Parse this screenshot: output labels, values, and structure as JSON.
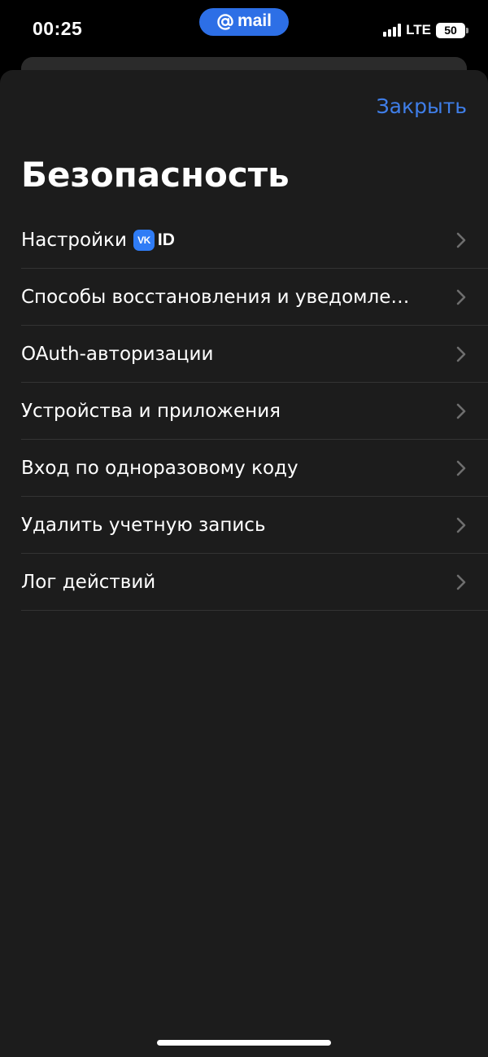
{
  "status_bar": {
    "time": "00:25",
    "app_pill_label": "mail",
    "network": "LTE",
    "battery": "50"
  },
  "sheet": {
    "close_label": "Закрыть",
    "title": "Безопасность"
  },
  "menu": {
    "items": [
      {
        "label": "Настройки",
        "badge_logo": "VK",
        "badge_text": "ID"
      },
      {
        "label": "Способы восстановления и уведомле…"
      },
      {
        "label": "OAuth-авторизации"
      },
      {
        "label": "Устройства и приложения"
      },
      {
        "label": "Вход по одноразовому коду"
      },
      {
        "label": "Удалить учетную запись"
      },
      {
        "label": "Лог действий"
      }
    ]
  },
  "colors": {
    "accent": "#3f7ee8",
    "sheet_bg": "#1c1c1c",
    "pill_bg": "#2d6fe6"
  }
}
